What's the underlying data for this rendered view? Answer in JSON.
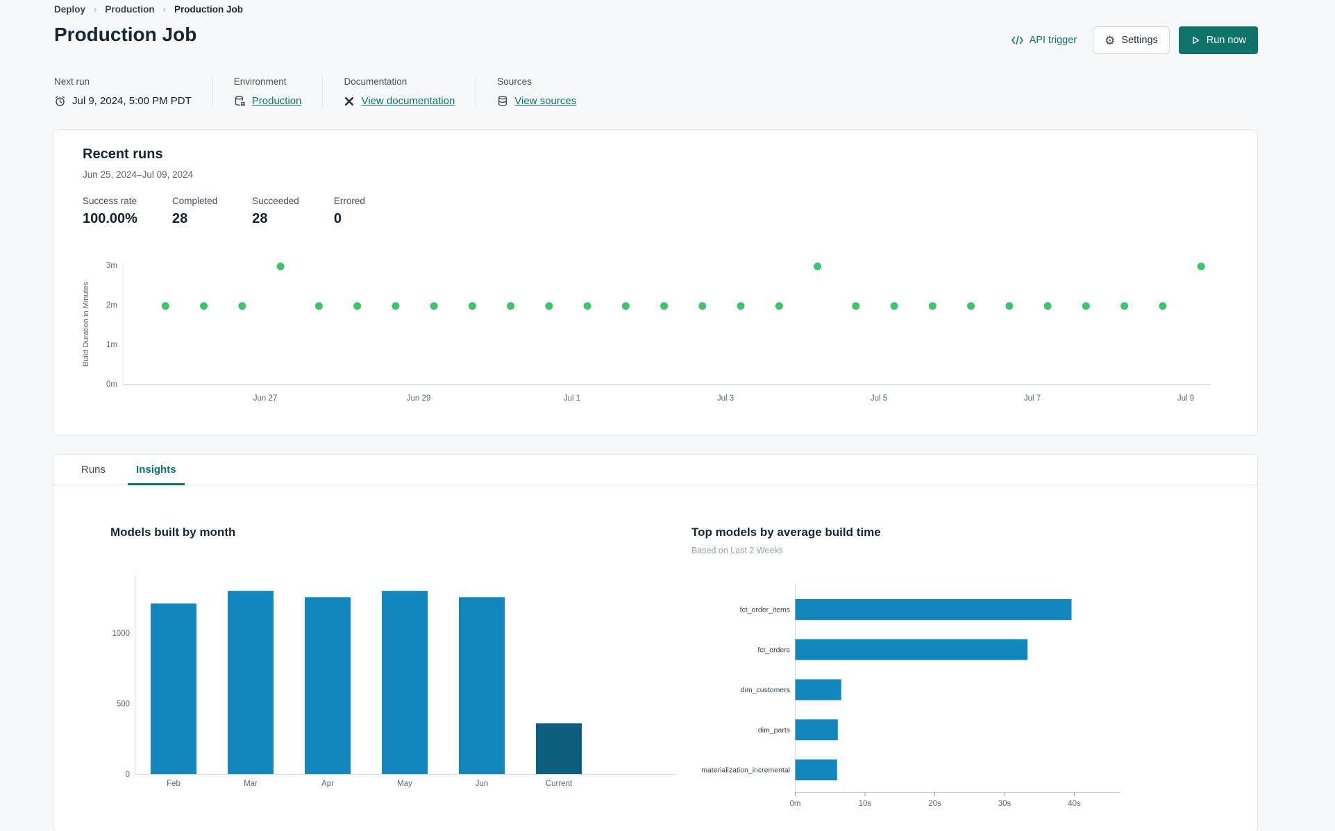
{
  "colors": {
    "accent_teal": "#0E7369",
    "bar_blue": "#1287BE",
    "bar_dark_blue": "#0D5D7C",
    "dot_green": "#3EC46A"
  },
  "breadcrumb": {
    "separator": "›",
    "items": [
      "Deploy",
      "Production",
      "Production Job"
    ]
  },
  "header": {
    "title": "Production Job",
    "api_trigger": "API trigger",
    "settings": "Settings",
    "run_now": "Run now"
  },
  "meta": {
    "next_run": {
      "label": "Next run",
      "value": "Jul 9, 2024, 5:00 PM PDT"
    },
    "environment": {
      "label": "Environment",
      "link": "Production"
    },
    "documentation": {
      "label": "Documentation",
      "link": "View documentation"
    },
    "sources": {
      "label": "Sources",
      "link": "View sources"
    }
  },
  "recent_runs": {
    "title": "Recent runs",
    "date_range": "Jun 25, 2024–Jul 09, 2024",
    "stats": [
      {
        "label": "Success rate",
        "value": "100.00%"
      },
      {
        "label": "Completed",
        "value": "28"
      },
      {
        "label": "Succeeded",
        "value": "28"
      },
      {
        "label": "Errored",
        "value": "0"
      }
    ]
  },
  "tabs": [
    {
      "label": "Runs",
      "active": false
    },
    {
      "label": "Insights",
      "active": true
    }
  ],
  "chart_data": [
    {
      "type": "scatter",
      "name": "recent-runs-build-duration",
      "ylabel": "Build Duration in Minutes",
      "ylim": [
        0,
        3.2
      ],
      "y_ticks": [
        {
          "value": 0,
          "label": "0m"
        },
        {
          "value": 1,
          "label": "1m"
        },
        {
          "value": 2,
          "label": "2m"
        },
        {
          "value": 3,
          "label": "3m"
        }
      ],
      "x_ticks": [
        {
          "day": 2,
          "label": "Jun 27"
        },
        {
          "day": 4,
          "label": "Jun 29"
        },
        {
          "day": 6,
          "label": "Jul 1"
        },
        {
          "day": 8,
          "label": "Jul 3"
        },
        {
          "day": 10,
          "label": "Jul 5"
        },
        {
          "day": 12,
          "label": "Jul 7"
        },
        {
          "day": 14,
          "label": "Jul 9"
        }
      ],
      "x_axis_note": "day 0 = Jun 25, 2024",
      "point_color": "#3EC46A",
      "points": [
        {
          "day": 0.7,
          "minutes": 1.97
        },
        {
          "day": 1.2,
          "minutes": 1.97
        },
        {
          "day": 1.7,
          "minutes": 1.97
        },
        {
          "day": 2.2,
          "minutes": 2.97
        },
        {
          "day": 2.7,
          "minutes": 1.97
        },
        {
          "day": 3.2,
          "minutes": 1.97
        },
        {
          "day": 3.7,
          "minutes": 1.97
        },
        {
          "day": 4.2,
          "minutes": 1.97
        },
        {
          "day": 4.7,
          "minutes": 1.97
        },
        {
          "day": 5.2,
          "minutes": 1.97
        },
        {
          "day": 5.7,
          "minutes": 1.97
        },
        {
          "day": 6.2,
          "minutes": 1.97
        },
        {
          "day": 6.7,
          "minutes": 1.97
        },
        {
          "day": 7.2,
          "minutes": 1.97
        },
        {
          "day": 7.7,
          "minutes": 1.97
        },
        {
          "day": 8.2,
          "minutes": 1.97
        },
        {
          "day": 8.7,
          "minutes": 1.97
        },
        {
          "day": 9.2,
          "minutes": 2.97
        },
        {
          "day": 9.7,
          "minutes": 1.97
        },
        {
          "day": 10.2,
          "minutes": 1.97
        },
        {
          "day": 10.7,
          "minutes": 1.97
        },
        {
          "day": 11.2,
          "minutes": 1.97
        },
        {
          "day": 11.7,
          "minutes": 1.97
        },
        {
          "day": 12.2,
          "minutes": 1.97
        },
        {
          "day": 12.7,
          "minutes": 1.97
        },
        {
          "day": 13.2,
          "minutes": 1.97
        },
        {
          "day": 13.7,
          "minutes": 1.97
        },
        {
          "day": 14.2,
          "minutes": 2.97
        }
      ]
    },
    {
      "type": "bar",
      "title": "Models built by month",
      "categories": [
        "Feb",
        "Mar",
        "Apr",
        "May",
        "Jun",
        "Current"
      ],
      "values": [
        1210,
        1300,
        1255,
        1300,
        1255,
        360
      ],
      "bar_colors": [
        "#1287BE",
        "#1287BE",
        "#1287BE",
        "#1287BE",
        "#1287BE",
        "#0D5D7C"
      ],
      "y_ticks": [
        0,
        500,
        1000
      ],
      "ylim": [
        0,
        1450
      ],
      "xlabel": "",
      "ylabel": ""
    },
    {
      "type": "bar-horizontal",
      "title": "Top models by average build time",
      "subtitle": "Based on Last 2 Weeks",
      "categories": [
        "fct_order_items",
        "fct_orders",
        "dim_customers",
        "dim_parts",
        "materialization_incremental"
      ],
      "values_seconds": [
        39.6,
        33.3,
        6.6,
        6.1,
        6.0
      ],
      "x_ticks": [
        {
          "value": 0,
          "label": "0m"
        },
        {
          "value": 10,
          "label": "10s"
        },
        {
          "value": 20,
          "label": "20s"
        },
        {
          "value": 30,
          "label": "30s"
        },
        {
          "value": 40,
          "label": "40s"
        }
      ],
      "xlim": [
        0,
        46
      ],
      "bar_color": "#1287BE"
    }
  ]
}
